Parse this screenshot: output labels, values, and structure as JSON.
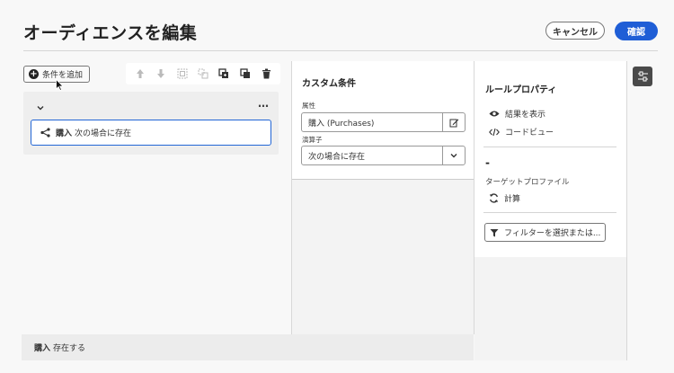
{
  "header": {
    "title": "オーディエンスを編集",
    "cancel_label": "キャンセル",
    "confirm_label": "確認"
  },
  "left": {
    "add_condition_label": "条件を追加",
    "toolbar_icons": [
      "arrow-up-icon",
      "arrow-down-icon",
      "group-icon",
      "ungroup-icon",
      "duplicate-icon",
      "copy-icon",
      "trash-icon"
    ],
    "more_label": "…",
    "condition": {
      "name": "購入",
      "operator": "次の場合に存在"
    }
  },
  "custom_condition": {
    "title": "カスタム条件",
    "attribute_label": "属性",
    "attribute_value": "購入 (Purchases)",
    "operator_label": "演算子",
    "operator_value": "次の場合に存在"
  },
  "rule_properties": {
    "title": "ルールプロパティ",
    "show_results": "結果を表示",
    "code_view": "コードビュー",
    "count_value": "-",
    "target_profiles_label": "ターゲットプロファイル",
    "calculate": "計算",
    "filter_button": "フィルターを選択または..."
  },
  "footer": {
    "name": "購入",
    "text": "存在する"
  },
  "colors": {
    "accent": "#1f5ed6",
    "selected_border": "#2266d6"
  }
}
